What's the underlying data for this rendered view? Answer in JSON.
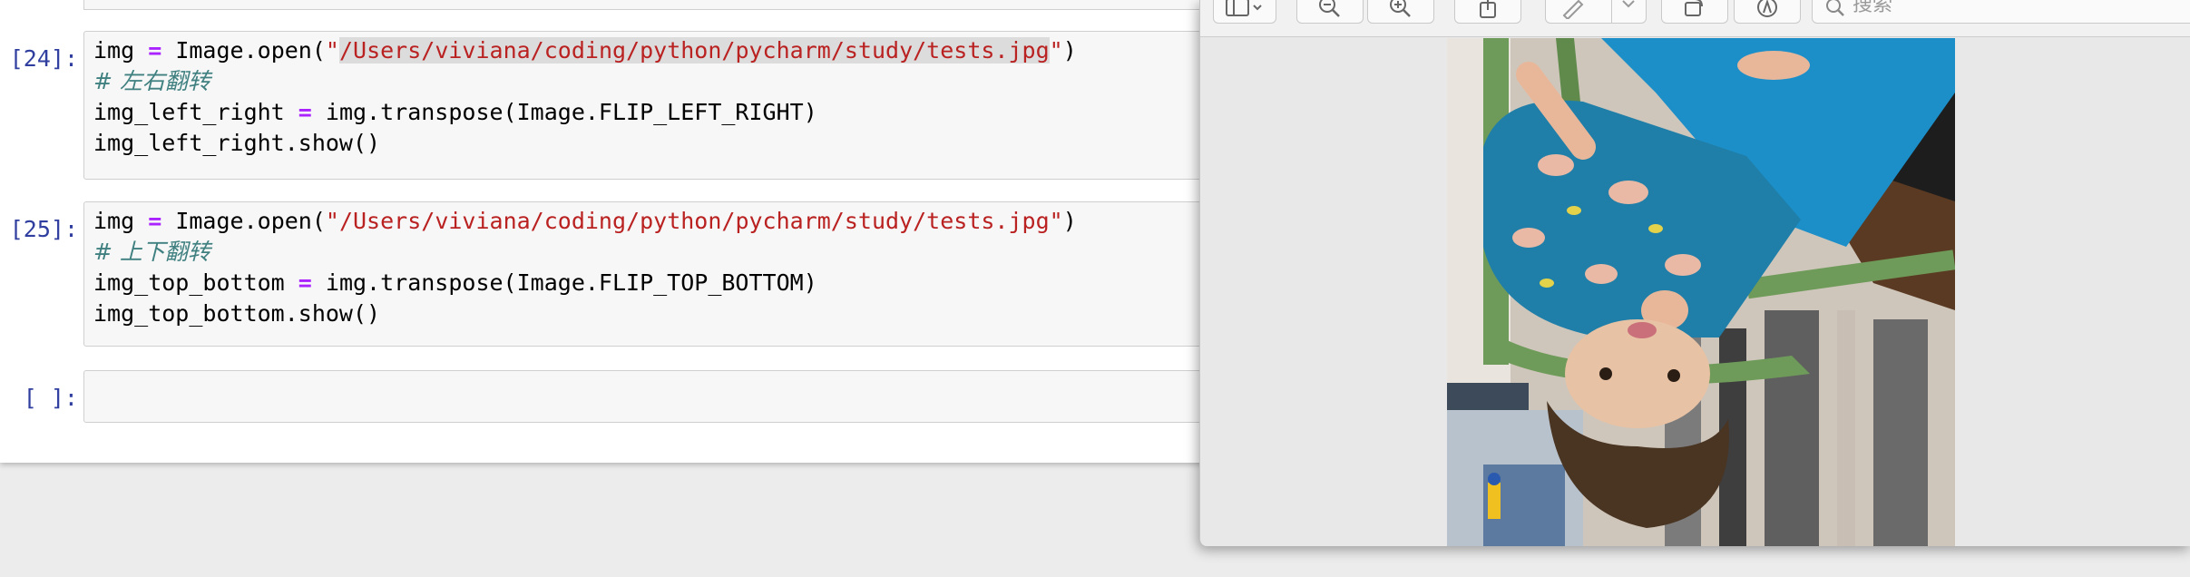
{
  "notebook": {
    "cells": [
      {
        "prompt": "[24]:",
        "line1": {
          "var": "img",
          "op": "=",
          "call_open": " Image.open(",
          "quote_open": "\"",
          "path": "/Users/viviana/coding/python/pycharm/study/tests.jpg",
          "quote_close": "\"",
          "paren_close": ")"
        },
        "comment": "# 左右翻转",
        "line3": {
          "var": "img_left_right",
          "op": "=",
          "rest": " img.transpose(Image.FLIP_LEFT_RIGHT)"
        },
        "line4": "img_left_right.show()"
      },
      {
        "prompt": "[25]:",
        "line1": {
          "var": "img",
          "op": "=",
          "call_open": " Image.open(",
          "string": "\"/Users/viviana/coding/python/pycharm/study/tests.jpg\"",
          "paren_close": ")"
        },
        "comment": "# 上下翻转",
        "line3": {
          "var": "img_top_bottom",
          "op": "=",
          "rest": " img.transpose(Image.FLIP_TOP_BOTTOM)"
        },
        "line4": "img_top_bottom.show()"
      },
      {
        "prompt": "[ ]:"
      }
    ]
  },
  "preview": {
    "search_placeholder": "搜索",
    "icons": [
      "sidebar-icon",
      "zoom-out-icon",
      "zoom-in-icon",
      "share-icon",
      "markup-pen-icon",
      "rotate-icon",
      "annotate-icon",
      "search-icon"
    ],
    "photo_description_colors": {
      "shirt": "#1c8fc9",
      "chair": "#6f9b5a",
      "hair": "#4a3422"
    }
  }
}
